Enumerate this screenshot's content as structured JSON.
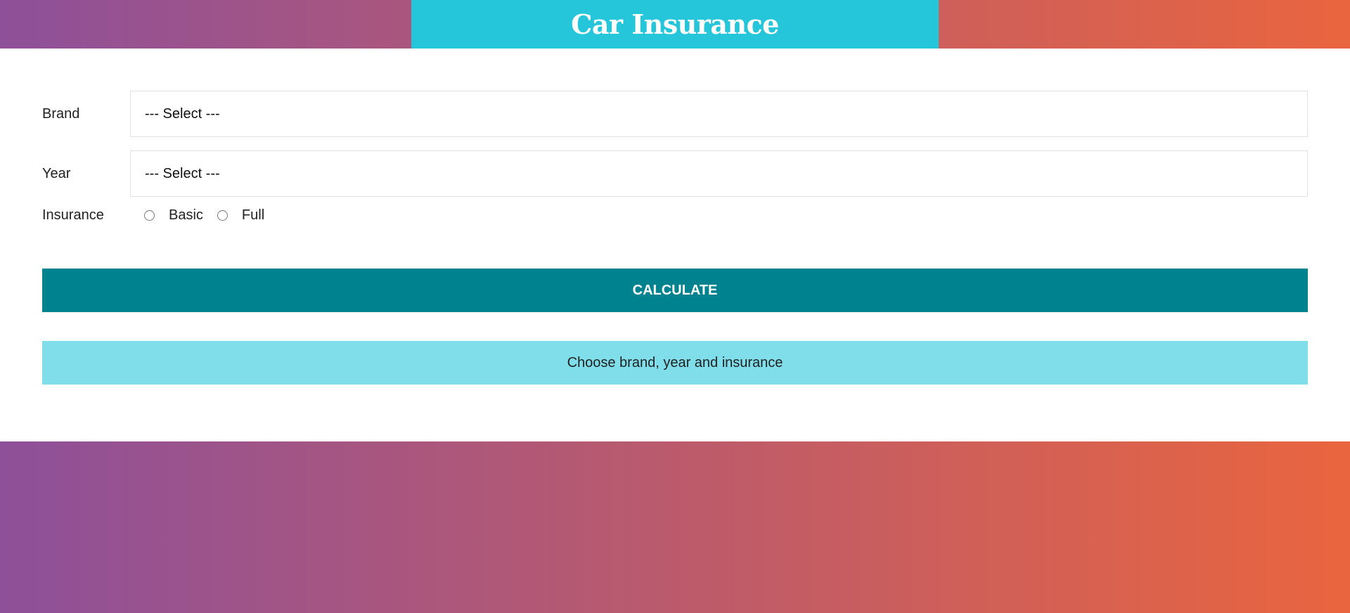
{
  "header": {
    "title": "Car Insurance"
  },
  "form": {
    "brand": {
      "label": "Brand",
      "selected": "--- Select ---"
    },
    "year": {
      "label": "Year",
      "selected": "--- Select ---"
    },
    "insurance": {
      "label": "Insurance",
      "options": [
        "Basic",
        "Full"
      ]
    },
    "calculate_label": "CALCULATE",
    "message": "Choose brand, year and insurance"
  },
  "colors": {
    "gradient_start": "#8e5099",
    "gradient_end": "#e9653f",
    "header_box": "#26c6da",
    "button": "#00838f",
    "message_bg": "#80deea"
  }
}
